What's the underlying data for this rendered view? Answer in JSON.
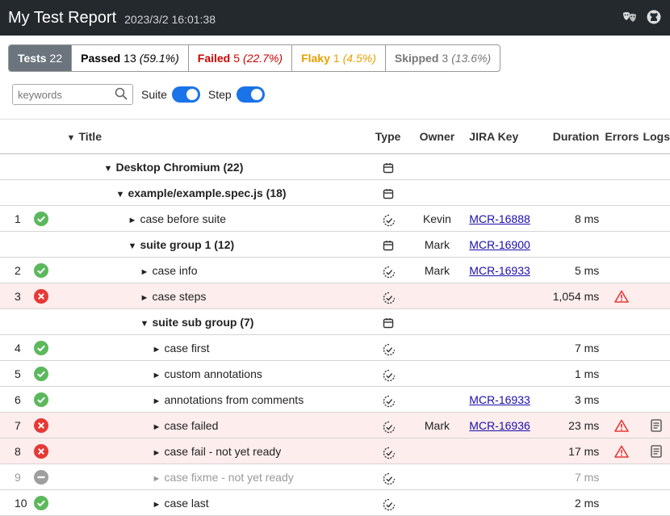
{
  "header": {
    "title": "My Test Report",
    "timestamp": "2023/3/2 16:01:38",
    "icons": [
      "theater-masks-icon",
      "github-icon"
    ]
  },
  "tabs": [
    {
      "label": "Tests",
      "count": "22",
      "pct": ""
    },
    {
      "label": "Passed",
      "count": "13",
      "pct": "(59.1%)"
    },
    {
      "label": "Failed",
      "count": "5",
      "pct": "(22.7%)"
    },
    {
      "label": "Flaky",
      "count": "1",
      "pct": "(4.5%)"
    },
    {
      "label": "Skipped",
      "count": "3",
      "pct": "(13.6%)"
    }
  ],
  "filters": {
    "search_placeholder": "keywords",
    "suite_label": "Suite",
    "step_label": "Step"
  },
  "columns": {
    "title": "Title",
    "type": "Type",
    "owner": "Owner",
    "jira": "JIRA Key",
    "duration": "Duration",
    "errors": "Errors",
    "logs": "Logs"
  },
  "rows": [
    {
      "num": "",
      "status": "",
      "level": 0,
      "kind": "suite",
      "title": "Desktop Chromium (22)",
      "owner": "",
      "jira": "",
      "duration": "",
      "error": false,
      "log": false
    },
    {
      "num": "",
      "status": "",
      "level": 1,
      "kind": "suite",
      "title": "example/example.spec.js (18)",
      "owner": "",
      "jira": "",
      "duration": "",
      "error": false,
      "log": false
    },
    {
      "num": "1",
      "status": "passed",
      "level": 2,
      "kind": "case",
      "title": "case before suite",
      "owner": "Kevin",
      "jira": "MCR-16888",
      "duration": "8 ms",
      "error": false,
      "log": false
    },
    {
      "num": "",
      "status": "",
      "level": 2,
      "kind": "suite",
      "title": "suite group 1 (12)",
      "owner": "Mark",
      "jira": "MCR-16900",
      "duration": "",
      "error": false,
      "log": false
    },
    {
      "num": "2",
      "status": "passed",
      "level": 3,
      "kind": "case",
      "title": "case info",
      "owner": "Mark",
      "jira": "MCR-16933",
      "duration": "5 ms",
      "error": false,
      "log": false
    },
    {
      "num": "3",
      "status": "failed",
      "level": 3,
      "kind": "case",
      "title": "case steps",
      "owner": "",
      "jira": "",
      "duration": "1,054 ms",
      "error": true,
      "log": false
    },
    {
      "num": "",
      "status": "",
      "level": 3,
      "kind": "suite",
      "title": "suite sub group (7)",
      "owner": "",
      "jira": "",
      "duration": "",
      "error": false,
      "log": false
    },
    {
      "num": "4",
      "status": "passed",
      "level": 4,
      "kind": "case",
      "title": "case first",
      "owner": "",
      "jira": "",
      "duration": "7 ms",
      "error": false,
      "log": false
    },
    {
      "num": "5",
      "status": "passed",
      "level": 4,
      "kind": "case",
      "title": "custom annotations",
      "owner": "",
      "jira": "",
      "duration": "1 ms",
      "error": false,
      "log": false
    },
    {
      "num": "6",
      "status": "passed",
      "level": 4,
      "kind": "case",
      "title": "annotations from comments",
      "owner": "",
      "jira": "MCR-16933",
      "duration": "3 ms",
      "error": false,
      "log": false
    },
    {
      "num": "7",
      "status": "failed",
      "level": 4,
      "kind": "case",
      "title": "case failed",
      "owner": "Mark",
      "jira": "MCR-16936",
      "duration": "23 ms",
      "error": true,
      "log": true
    },
    {
      "num": "8",
      "status": "failed",
      "level": 4,
      "kind": "case",
      "title": "case fail - not yet ready",
      "owner": "",
      "jira": "",
      "duration": "17 ms",
      "error": true,
      "log": true
    },
    {
      "num": "9",
      "status": "skipped",
      "level": 4,
      "kind": "case",
      "title": "case fixme - not yet ready",
      "owner": "",
      "jira": "",
      "duration": "7 ms",
      "error": false,
      "log": false
    },
    {
      "num": "10",
      "status": "passed",
      "level": 4,
      "kind": "case",
      "title": "case last",
      "owner": "",
      "jira": "",
      "duration": "2 ms",
      "error": false,
      "log": false
    }
  ],
  "colors": {
    "passed": "#5cb85c",
    "failed": "#e53935",
    "skipped": "#9e9e9e",
    "header_bg": "#24292e",
    "toggle": "#1a73e8",
    "fail_row": "#fdeded"
  }
}
